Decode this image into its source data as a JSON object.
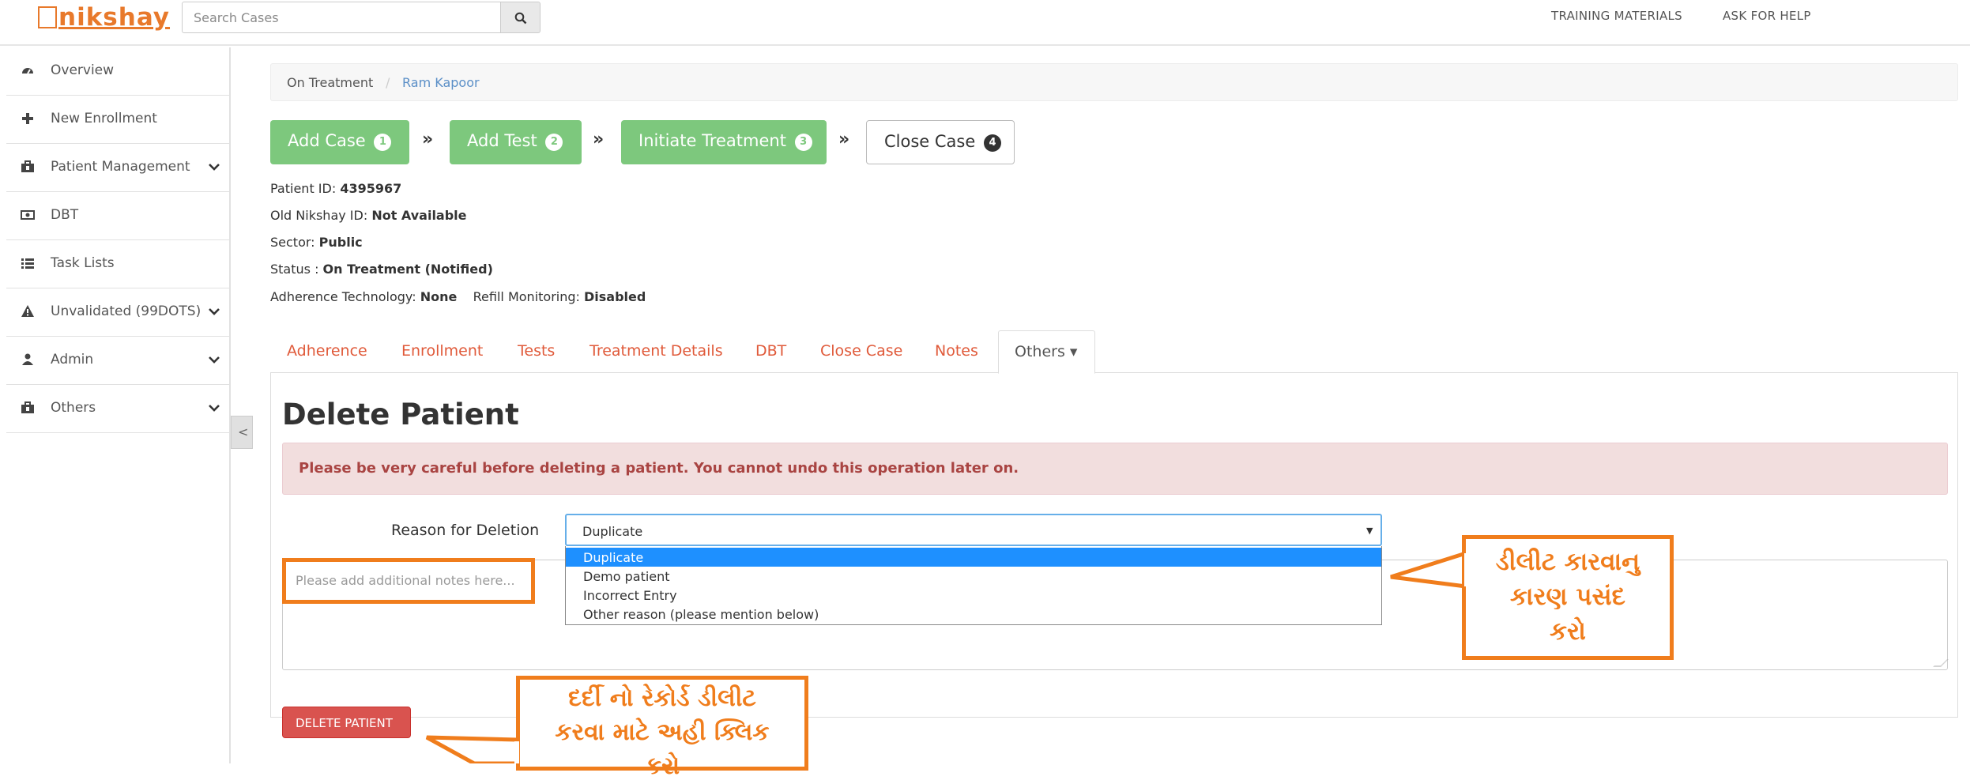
{
  "header": {
    "logo_text": "nikshay",
    "search_placeholder": "Search Cases",
    "links": [
      "TRAINING MATERIALS",
      "ASK FOR HELP"
    ]
  },
  "sidebar": {
    "items": [
      {
        "label": "Overview",
        "icon": "dashboard-icon"
      },
      {
        "label": "New Enrollment",
        "icon": "plus-icon"
      },
      {
        "label": "Patient Management",
        "icon": "briefcase-icon",
        "expandable": true
      },
      {
        "label": "DBT",
        "icon": "money-icon"
      },
      {
        "label": "Task Lists",
        "icon": "list-icon"
      },
      {
        "label": "Unvalidated (99DOTS)",
        "icon": "warning-icon",
        "expandable": true
      },
      {
        "label": "Admin",
        "icon": "user-icon",
        "expandable": true
      },
      {
        "label": "Others",
        "icon": "briefcase-icon",
        "expandable": true
      }
    ]
  },
  "breadcrumb": {
    "parent": "On Treatment",
    "current": "Ram Kapoor"
  },
  "steps": [
    {
      "label": "Add Case",
      "num": "1"
    },
    {
      "label": "Add Test",
      "num": "2"
    },
    {
      "label": "Initiate Treatment",
      "num": "3"
    },
    {
      "label": "Close Case",
      "num": "4"
    }
  ],
  "patient": {
    "id_label": "Patient ID: ",
    "id": "4395967",
    "old_id_label": "Old Nikshay ID: ",
    "old_id": "Not Available",
    "sector_label": "Sector: ",
    "sector": "Public",
    "status_label": "Status : ",
    "status": "On Treatment (Notified)",
    "adherence_label": "Adherence Technology: ",
    "adherence": "None",
    "refill_label": "Refill Monitoring: ",
    "refill": "Disabled"
  },
  "tabs": [
    "Adherence",
    "Enrollment",
    "Tests",
    "Treatment Details",
    "DBT",
    "Close Case",
    "Notes",
    "Others ▾"
  ],
  "form": {
    "title": "Delete Patient",
    "warning": "Please be very careful before deleting a patient. You cannot undo this operation later on.",
    "reason_label": "Reason for Deletion",
    "reason_selected": "Duplicate",
    "options": [
      "Duplicate",
      "Demo patient",
      "Incorrect Entry",
      "Other reason (please mention below)"
    ],
    "notes_placeholder": "Please add additional notes here...",
    "delete_button": "DELETE PATIENT"
  },
  "callouts": {
    "reason_hint": [
      "ડીલીટ કારવાનુ",
      "કારણ પસંદ",
      "કરો"
    ],
    "delete_hint": [
      "દર્દી નો રેકોર્ડ ડીલીટ",
      "કરવા માટે અહી ક્લિક",
      "કરો"
    ]
  },
  "colors": {
    "accent": "#f07d1c",
    "step_green": "#7dc87d",
    "tab_red": "#e05a3a",
    "danger": "#d9534f",
    "link_blue": "#5b8fc7"
  }
}
